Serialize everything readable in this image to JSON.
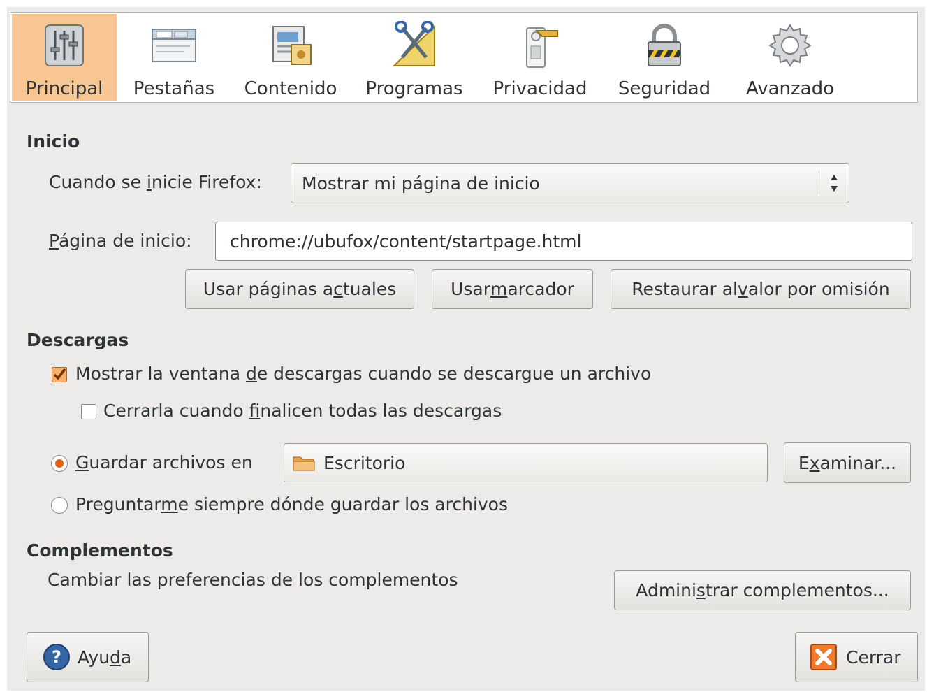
{
  "toolbar": {
    "items": [
      {
        "label": "Principal",
        "icon": "sliders-icon",
        "selected": true
      },
      {
        "label": "Pestañas",
        "icon": "tabs-window-icon",
        "selected": false
      },
      {
        "label": "Contenido",
        "icon": "content-icon",
        "selected": false
      },
      {
        "label": "Programas",
        "icon": "applications-tools-icon",
        "selected": false
      },
      {
        "label": "Privacidad",
        "icon": "door-hanger-icon",
        "selected": false
      },
      {
        "label": "Seguridad",
        "icon": "padlock-icon",
        "selected": false
      },
      {
        "label": "Avanzado",
        "icon": "gear-icon",
        "selected": false
      }
    ]
  },
  "inicio": {
    "heading": "Inicio",
    "startup_label_pre": "Cuando se ",
    "startup_label_u": "i",
    "startup_label_post": "nicie Firefox:",
    "startup_value": "Mostrar mi página de inicio",
    "homepage_label_u": "P",
    "homepage_label_post": "ágina de inicio:",
    "homepage_value": "chrome://ubufox/content/startpage.html",
    "btn_current_pre": "Usar páginas a",
    "btn_current_u": "c",
    "btn_current_post": "tuales",
    "btn_bookmark_pre": "Usar ",
    "btn_bookmark_u": "m",
    "btn_bookmark_post": "arcador",
    "btn_restore_pre": "Restaurar al ",
    "btn_restore_u": "v",
    "btn_restore_post": "alor por omisión"
  },
  "descargas": {
    "heading": "Descargas",
    "show_window_pre": "Mostrar la ventana ",
    "show_window_u": "d",
    "show_window_post": "e descargas cuando se descargue un archivo",
    "show_window_checked": true,
    "close_when_pre": "Cerrarla cuando ",
    "close_when_u": "f",
    "close_when_post": "inalicen todas las descargas",
    "close_when_checked": false,
    "save_to_u": "G",
    "save_to_post": "uardar archivos en",
    "save_to_selected": true,
    "folder_value": "Escritorio",
    "browse_pre": "E",
    "browse_u": "x",
    "browse_post": "aminar...",
    "ask_pre": "Preguntar",
    "ask_u": "m",
    "ask_post": "e siempre dónde guardar los archivos",
    "ask_selected": false
  },
  "complementos": {
    "heading": "Complementos",
    "description": "Cambiar las preferencias de los complementos",
    "manage_pre": "Admini",
    "manage_u": "s",
    "manage_post": "trar complementos..."
  },
  "footer": {
    "help_pre": "Ayu",
    "help_u": "d",
    "help_post": "a",
    "close_label": "Cerrar"
  },
  "colors": {
    "selected_tab_bg": "#f8c692",
    "dialog_bg": "#edebe9",
    "accent_orange": "#e2621a"
  }
}
